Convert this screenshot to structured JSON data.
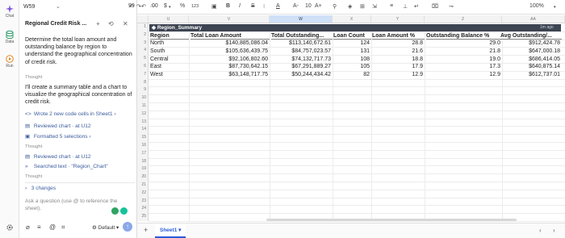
{
  "rail": {
    "items": [
      {
        "label": "Chat",
        "icon": "sparkle-icon"
      },
      {
        "label": "Data",
        "icon": "database-icon"
      },
      {
        "label": "Run",
        "icon": "play-icon"
      }
    ]
  },
  "name_box": "W59",
  "chat": {
    "title": "Regional Credit Risk ...",
    "user_message": "Determine the total loan amount and outstanding balance by region to understand the geographical concentration of credit risk.",
    "thought_label": "Thought",
    "assistant_message": "I'll create a summary table and a chart to visualize the geographical concentration of credit risk.",
    "actions": [
      "Wrote 2 new code cells in Sheet1",
      "Reviewed chart · at U12",
      "Formatted 5 selections",
      "Reviewed chart · at U12",
      "Searched text · \"Region_Chart\""
    ],
    "changes": "3 changes",
    "ask_placeholder": "Ask a question (use @ to reference the sheet).",
    "model": "Default"
  },
  "toolbar": {
    "undo": "↶",
    "redo": "↷",
    "format_99": "99",
    "decimals": ".00",
    "currency": "$",
    "percent": "%",
    "number": "123",
    "font_size": "10",
    "zoom": "100%"
  },
  "columns": [
    "U",
    "V",
    "W",
    "X",
    "Y",
    "Z",
    "AA"
  ],
  "rows": [
    "1",
    "2",
    "3",
    "4",
    "5",
    "6",
    "7",
    "8",
    "9",
    "10",
    "11",
    "12",
    "13",
    "14",
    "15",
    "16",
    "17",
    "18",
    "19",
    "20",
    "21",
    "22",
    "23",
    "24",
    "25"
  ],
  "table": {
    "title": "Region_Summary",
    "updated": "1m ago",
    "headers": [
      "Region",
      "Total Loan Amount",
      "Total Outstanding...",
      "Loan Count",
      "Loan Amount %",
      "Outstanding Balance %",
      "Avg Outstanding/..."
    ],
    "rows": [
      [
        "North",
        "$140,885,086.04",
        "$113,140,672.61",
        "124",
        "28.8",
        "29.0",
        "$912,424.78"
      ],
      [
        "South",
        "$105,636,439.75",
        "$84,757,023.57",
        "131",
        "21.6",
        "21.8",
        "$647,000.18"
      ],
      [
        "Central",
        "$92,106,802.60",
        "$74,132,717.73",
        "108",
        "18.8",
        "19.0",
        "$686,414.05"
      ],
      [
        "East",
        "$87,730,642.15",
        "$67,291,889.27",
        "105",
        "17.9",
        "17.3",
        "$640,875.14"
      ],
      [
        "West",
        "$63,148,717.75",
        "$50,244,434.42",
        "82",
        "12.9",
        "12.9",
        "$612,737.01"
      ]
    ]
  },
  "sheets": [
    "Sheet1"
  ]
}
